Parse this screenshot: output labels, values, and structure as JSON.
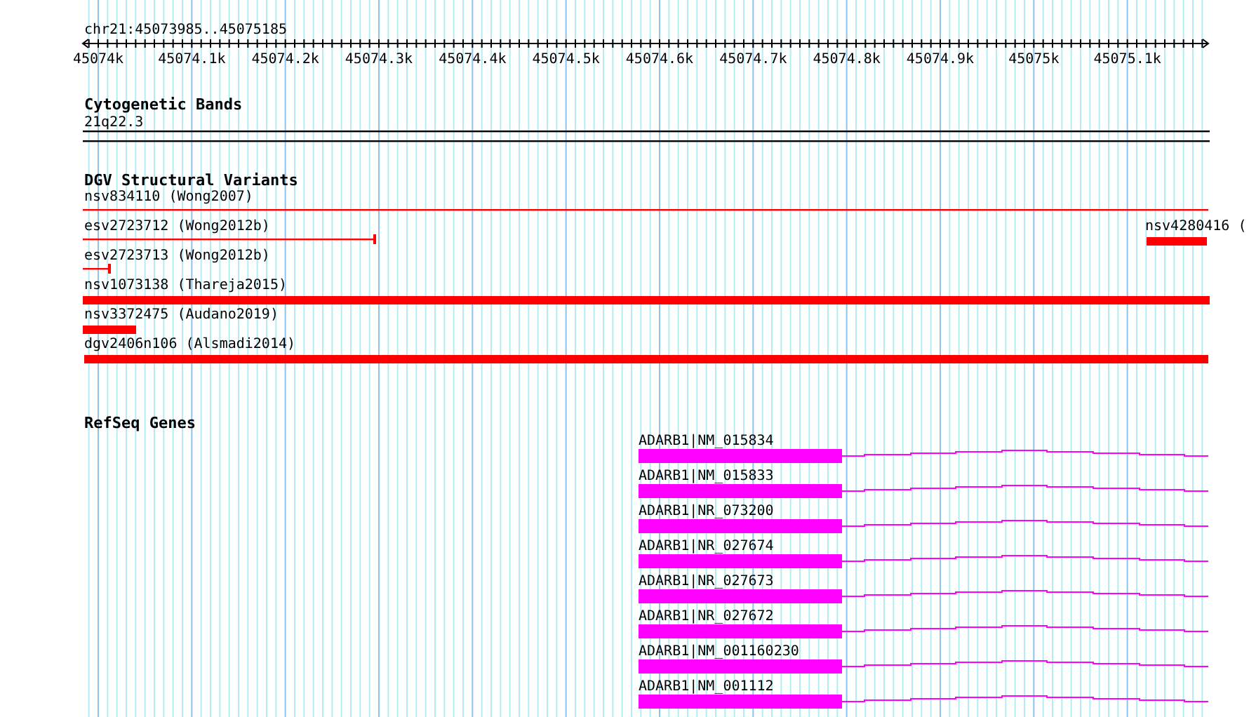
{
  "ruler": {
    "region": "chr21:45073985..45075185",
    "ticks": [
      "45074k",
      "45074.1k",
      "45074.2k",
      "45074.3k",
      "45074.4k",
      "45074.5k",
      "45074.6k",
      "45074.7k",
      "45074.8k",
      "45074.9k",
      "45075k",
      "45075.1k"
    ]
  },
  "tracks": [
    {
      "title": "Cytogenetic Bands",
      "kind": "bands",
      "features": [
        {
          "label": "21q22.3",
          "kind": "band"
        }
      ]
    },
    {
      "title": "DGV Structural Variants",
      "kind": "variants",
      "features": [
        {
          "label": "nsv834110 (Wong2007)",
          "kind": "line"
        },
        {
          "label": "esv2723712 (Wong2012b)",
          "kind": "line"
        },
        {
          "label": "nsv4280416 (",
          "kind": "bar"
        },
        {
          "label": "esv2723713 (Wong2012b)",
          "kind": "line"
        },
        {
          "label": "nsv1073138 (Thareja2015)",
          "kind": "bar"
        },
        {
          "label": "nsv3372475 (Audano2019)",
          "kind": "bar"
        },
        {
          "label": "dgv2406n106 (Alsmadi2014)",
          "kind": "bar"
        }
      ]
    },
    {
      "title": "RefSeq Genes",
      "kind": "genes",
      "features": [
        {
          "label": "ADARB1|NM_015834",
          "kind": "transcript"
        },
        {
          "label": "ADARB1|NM_015833",
          "kind": "transcript"
        },
        {
          "label": "ADARB1|NR_073200",
          "kind": "transcript"
        },
        {
          "label": "ADARB1|NR_027674",
          "kind": "transcript"
        },
        {
          "label": "ADARB1|NR_027673",
          "kind": "transcript"
        },
        {
          "label": "ADARB1|NR_027672",
          "kind": "transcript"
        },
        {
          "label": "ADARB1|NM_001160230",
          "kind": "transcript"
        },
        {
          "label": "ADARB1|NM_001112",
          "kind": "transcript"
        }
      ]
    }
  ]
}
